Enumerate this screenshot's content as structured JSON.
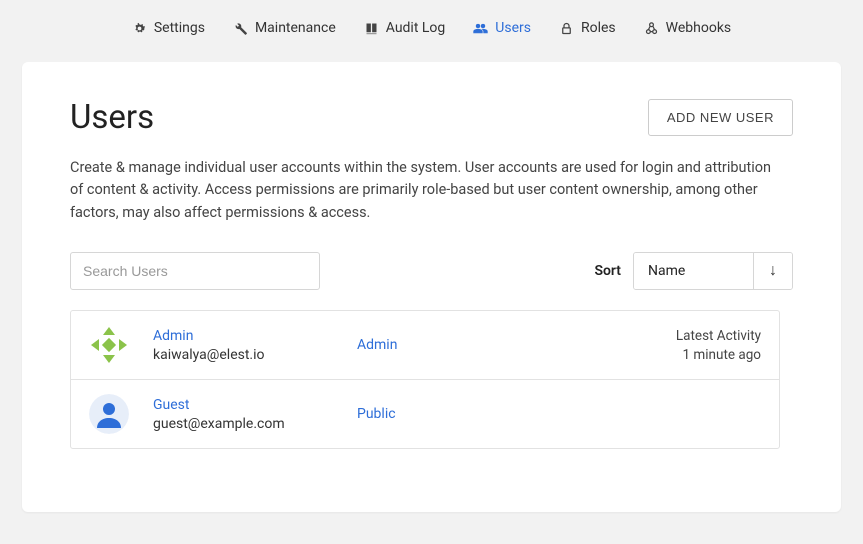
{
  "nav": {
    "items": [
      {
        "id": "settings",
        "label": "Settings",
        "active": false
      },
      {
        "id": "maintenance",
        "label": "Maintenance",
        "active": false
      },
      {
        "id": "audit-log",
        "label": "Audit Log",
        "active": false
      },
      {
        "id": "users",
        "label": "Users",
        "active": true
      },
      {
        "id": "roles",
        "label": "Roles",
        "active": false
      },
      {
        "id": "webhooks",
        "label": "Webhooks",
        "active": false
      }
    ]
  },
  "page": {
    "title": "Users",
    "add_button": "ADD NEW USER",
    "description": "Create & manage individual user accounts within the system. User accounts are used for login and attribution of content & activity. Access permissions are primarily role-based but user content ownership, among other factors, may also affect permissions & access."
  },
  "search": {
    "placeholder": "Search Users",
    "value": ""
  },
  "sort": {
    "label": "Sort",
    "selected": "Name",
    "direction_icon": "↓"
  },
  "activity_label": "Latest Activity",
  "users": [
    {
      "name": "Admin",
      "email": "kaiwalya@elest.io",
      "role": "Admin",
      "activity_time": "1 minute ago",
      "avatar_type": "pattern"
    },
    {
      "name": "Guest",
      "email": "guest@example.com",
      "role": "Public",
      "activity_time": "",
      "avatar_type": "generic"
    }
  ],
  "colors": {
    "accent": "#2e6ed8",
    "bg": "#f2f2f2",
    "card": "#ffffff"
  }
}
